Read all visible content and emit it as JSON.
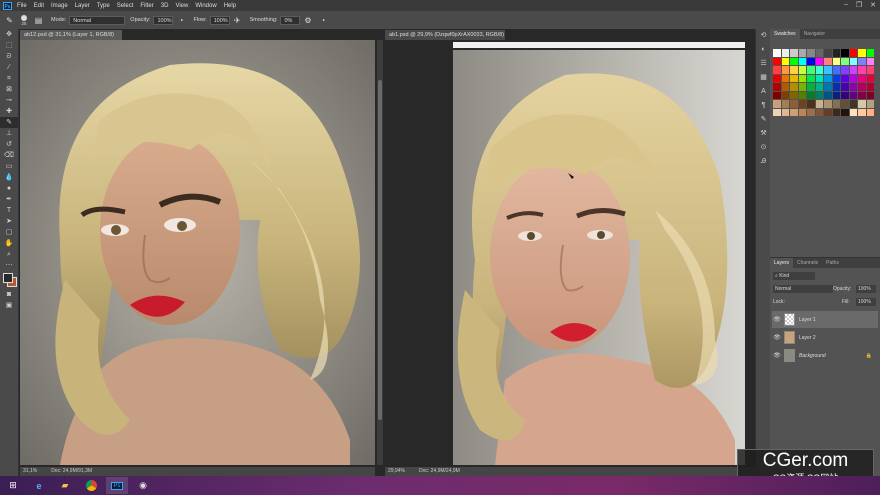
{
  "app_icon": "Ps",
  "menu": [
    "File",
    "Edit",
    "Image",
    "Layer",
    "Type",
    "Select",
    "Filter",
    "3D",
    "View",
    "Window",
    "Help"
  ],
  "window_controls": [
    "–",
    "❐",
    "✕"
  ],
  "options": {
    "brush_size": "25",
    "mode_label": "Mode:",
    "mode_value": "Normal",
    "opacity_label": "Opacity:",
    "opacity_value": "100%",
    "flow_label": "Flow:",
    "flow_value": "100%",
    "smoothing_label": "Smoothing:",
    "smoothing_value": "0%"
  },
  "tools": [
    "move",
    "marquee",
    "lasso",
    "quick-select",
    "crop",
    "frame",
    "eyedropper",
    "healing",
    "brush",
    "clone-stamp",
    "history-brush",
    "eraser",
    "gradient",
    "blur",
    "dodge",
    "pen",
    "type",
    "path-select",
    "shape",
    "hand",
    "zoom",
    "more"
  ],
  "doc1": {
    "tab_title": "ab12.psd @ 31,1% (Layer 1, RGB/8) *",
    "zoom": "31,1%",
    "doc_info": "Doc: 24,9M/91,3M"
  },
  "doc2": {
    "tab_title": "ab1.psd @ 29,9% (Dzqwf0pXrAX0033, RGB/8) *",
    "zoom": "29,94%",
    "doc_info": "Doc: 24,9M/24,9M"
  },
  "panels": {
    "swatches_tabs": [
      "Swatches",
      "Navigator"
    ],
    "layers_tabs": [
      "Layers",
      "Channels",
      "Paths"
    ],
    "kind_label": "Kind",
    "blend_mode": "Normal",
    "opacity_label": "Opacity:",
    "opacity_value": "100%",
    "lock_label": "Lock:",
    "fill_label": "Fill:",
    "fill_value": "100%",
    "layers": [
      {
        "name": "Layer 1",
        "selected": true
      },
      {
        "name": "Layer 2",
        "selected": false
      },
      {
        "name": "Background",
        "selected": false,
        "locked": true
      }
    ]
  },
  "taskbar_icons": [
    "windows-start",
    "internet-explorer",
    "file-explorer",
    "chrome",
    "photoshop",
    "obs"
  ],
  "watermark": {
    "big": "CGer.com",
    "small": "CG资源 CG网站"
  },
  "colors": {
    "accent": "#31a8ff",
    "fg_color": "#2a2a2a",
    "bg_color": "#b05a37"
  }
}
